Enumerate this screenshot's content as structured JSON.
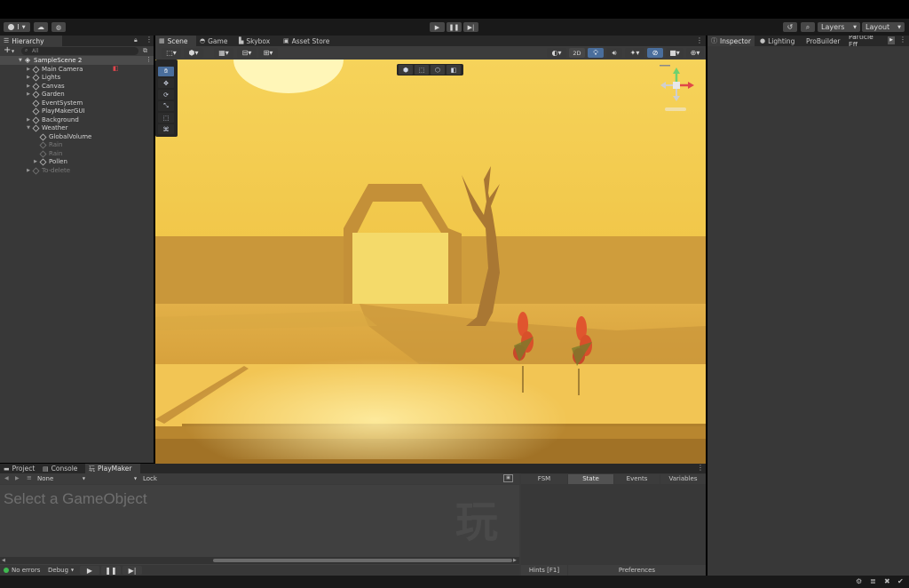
{
  "toolbar": {
    "account_label": "I",
    "layers_label": "Layers",
    "layout_label": "Layout"
  },
  "hierarchy": {
    "tab_label": "Hierarchy",
    "search_placeholder": "All",
    "scene_name": "SampleScene 2",
    "items": [
      {
        "label": "Main Camera",
        "indent": 1,
        "arrow": "▶",
        "dim": false
      },
      {
        "label": "Lights",
        "indent": 1,
        "arrow": "▶",
        "dim": false
      },
      {
        "label": "Canvas",
        "indent": 1,
        "arrow": "▶",
        "dim": false
      },
      {
        "label": "Garden",
        "indent": 1,
        "arrow": "▶",
        "dim": false
      },
      {
        "label": "EventSystem",
        "indent": 1,
        "arrow": "",
        "dim": false
      },
      {
        "label": "PlayMakerGUI",
        "indent": 1,
        "arrow": "",
        "dim": false
      },
      {
        "label": "Background",
        "indent": 1,
        "arrow": "▶",
        "dim": false
      },
      {
        "label": "Weather",
        "indent": 1,
        "arrow": "▼",
        "dim": false
      },
      {
        "label": "GlobalVolume",
        "indent": 2,
        "arrow": "",
        "dim": false
      },
      {
        "label": "Rain",
        "indent": 2,
        "arrow": "",
        "dim": true
      },
      {
        "label": "Rain",
        "indent": 2,
        "arrow": "",
        "dim": true
      },
      {
        "label": "Pollen",
        "indent": 2,
        "arrow": "▶",
        "dim": false
      },
      {
        "label": "To-delete",
        "indent": 1,
        "arrow": "▶",
        "dim": true
      }
    ]
  },
  "scene_tabs": {
    "scene": "Scene",
    "game": "Game",
    "skybox": "Skybox",
    "asset_store": "Asset Store"
  },
  "scene_toolbar": {
    "mode_2d": "2D"
  },
  "inspector_tabs": {
    "inspector": "Inspector",
    "lighting": "Lighting",
    "probuilder": "ProBuilder",
    "particle": "Particle Eff"
  },
  "bottom_tabs": {
    "project": "Project",
    "console": "Console",
    "playmaker": "PlayMaker"
  },
  "playmaker": {
    "none_label": "None",
    "lock_label": "Lock",
    "select_text": "Select a GameObject",
    "watermark": "玩",
    "tabs": {
      "fsm": "FSM",
      "state": "State",
      "events": "Events",
      "variables": "Variables"
    },
    "status_errors": "No errors",
    "debug_label": "Debug",
    "hints_label": "Hints [F1]",
    "preferences_label": "Preferences"
  },
  "colors": {
    "status_ok": "#3fb950",
    "accent_blue": "#4a6e9c",
    "camera_red": "#e0454c",
    "sky_yellow": "#f3c94a"
  }
}
